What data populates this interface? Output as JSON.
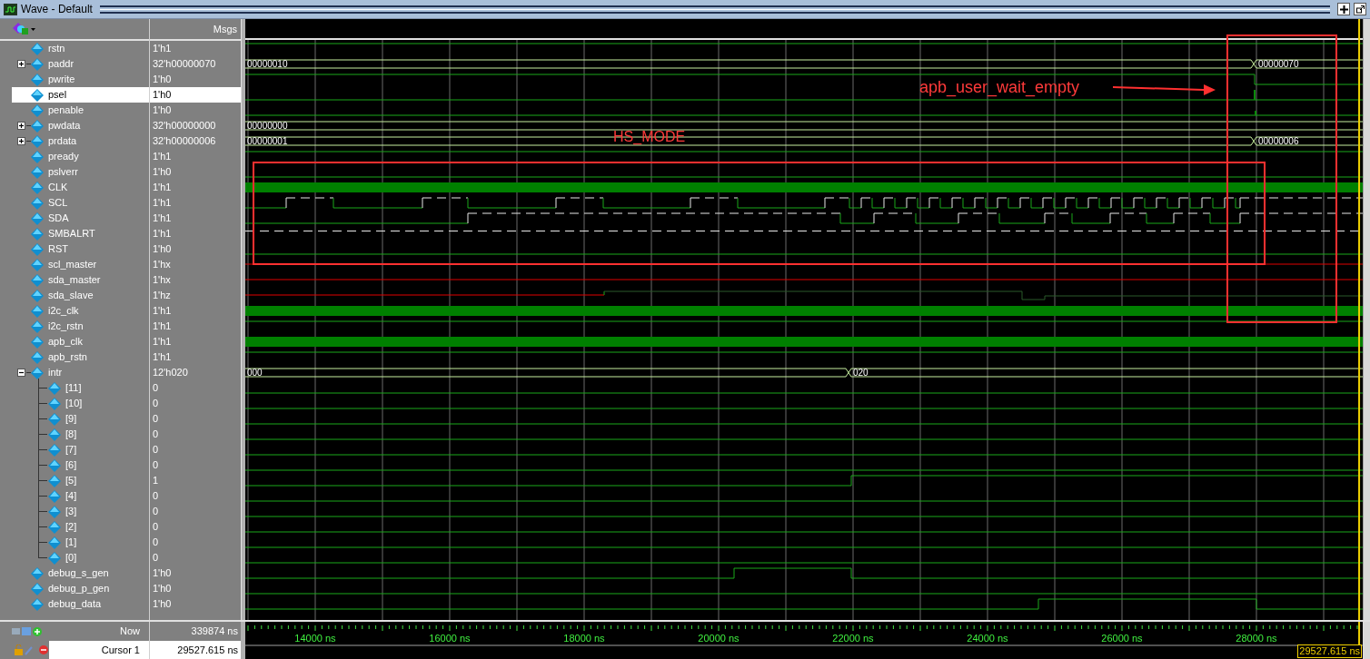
{
  "window": {
    "title": "Wave - Default"
  },
  "header": {
    "values_label": "Msgs"
  },
  "signals": [
    {
      "name": "rstn",
      "value": "1'h1",
      "selected": false
    },
    {
      "name": "paddr",
      "value": "32'h00000070",
      "selected": false,
      "expanded": false,
      "wave_labels": [
        "00000010",
        "00000070"
      ]
    },
    {
      "name": "pwrite",
      "value": "1'h0",
      "selected": false
    },
    {
      "name": "psel",
      "value": "1'h0",
      "selected": true
    },
    {
      "name": "penable",
      "value": "1'h0",
      "selected": false
    },
    {
      "name": "pwdata",
      "value": "32'h00000000",
      "selected": false,
      "expanded": false,
      "wave_labels": [
        "00000000"
      ]
    },
    {
      "name": "prdata",
      "value": "32'h00000006",
      "selected": false,
      "expanded": false,
      "wave_labels": [
        "00000001",
        "00000006"
      ]
    },
    {
      "name": "pready",
      "value": "1'h1",
      "selected": false
    },
    {
      "name": "pslverr",
      "value": "1'h0",
      "selected": false
    },
    {
      "name": "CLK",
      "value": "1'h1",
      "selected": false
    },
    {
      "name": "SCL",
      "value": "1'h1",
      "selected": false
    },
    {
      "name": "SDA",
      "value": "1'h1",
      "selected": false
    },
    {
      "name": "SMBALRT",
      "value": "1'h1",
      "selected": false
    },
    {
      "name": "RST",
      "value": "1'h0",
      "selected": false
    },
    {
      "name": "scl_master",
      "value": "1'hx",
      "selected": false
    },
    {
      "name": "sda_master",
      "value": "1'hx",
      "selected": false
    },
    {
      "name": "sda_slave",
      "value": "1'hz",
      "selected": false
    },
    {
      "name": "i2c_clk",
      "value": "1'h1",
      "selected": false
    },
    {
      "name": "i2c_rstn",
      "value": "1'h1",
      "selected": false
    },
    {
      "name": "apb_clk",
      "value": "1'h1",
      "selected": false
    },
    {
      "name": "apb_rstn",
      "value": "1'h1",
      "selected": false
    },
    {
      "name": "intr",
      "value": "12'h020",
      "selected": false,
      "expanded": true,
      "wave_labels": [
        "000",
        "020"
      ],
      "children": [
        {
          "name": "[11]",
          "value": "0",
          "selected": false
        },
        {
          "name": "[10]",
          "value": "0",
          "selected": false
        },
        {
          "name": "[9]",
          "value": "0",
          "selected": false
        },
        {
          "name": "[8]",
          "value": "0",
          "selected": false
        },
        {
          "name": "[7]",
          "value": "0",
          "selected": false
        },
        {
          "name": "[6]",
          "value": "0",
          "selected": false
        },
        {
          "name": "[5]",
          "value": "1",
          "selected": false
        },
        {
          "name": "[4]",
          "value": "0",
          "selected": false
        },
        {
          "name": "[3]",
          "value": "0",
          "selected": false
        },
        {
          "name": "[2]",
          "value": "0",
          "selected": false
        },
        {
          "name": "[1]",
          "value": "0",
          "selected": false
        },
        {
          "name": "[0]",
          "value": "0",
          "selected": false
        }
      ]
    },
    {
      "name": "debug_s_gen",
      "value": "1'h0",
      "selected": false
    },
    {
      "name": "debug_p_gen",
      "value": "1'h0",
      "selected": false
    },
    {
      "name": "debug_data",
      "value": "1'h0",
      "selected": false
    }
  ],
  "annotations": [
    {
      "kind": "box"
    },
    {
      "kind": "label",
      "text": "apb_user_wait_empty"
    },
    {
      "kind": "arrow"
    },
    {
      "kind": "label",
      "text": "HS_MODE"
    },
    {
      "kind": "box"
    }
  ],
  "now": {
    "label": "Now",
    "value": "339874 ns"
  },
  "cursor": {
    "label": "Cursor 1",
    "value": "29527.615 ns",
    "marker": "29527.615 ns"
  },
  "time_axis": [
    "14000 ns",
    "16000 ns",
    "18000 ns",
    "20000 ns",
    "22000 ns",
    "24000 ns",
    "26000 ns",
    "28000 ns"
  ]
}
